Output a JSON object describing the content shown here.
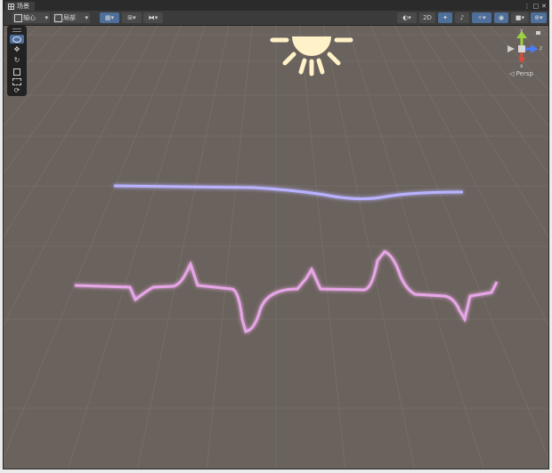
{
  "window": {
    "tab_title": "场景",
    "tab_icon": "grid-icon",
    "controls": [
      "⋮",
      "□",
      "✕"
    ]
  },
  "toolbar": {
    "pivot_label": "轴心",
    "space_label": "局部",
    "mode_2d_label": "2D"
  },
  "gizmo": {
    "axis_y": "y",
    "axis_z": "z",
    "axis_x": "x",
    "persp_label": "◁ Persp"
  },
  "colors": {
    "scene_background": "#6a625c",
    "grid_line": "#77706a",
    "line_upper": "#b8b2ff",
    "line_lower": "#e7a6e6",
    "sun": "#fff2c8",
    "axis_y": "#9cd13f",
    "axis_z": "#4a7bff",
    "axis_x": "#e04a3b"
  },
  "tool_panel": {
    "tools": [
      "view-tool-icon",
      "move-tool-icon",
      "rotate-tool-icon",
      "scale-tool-icon",
      "rect-tool-icon",
      "transform-tool-icon"
    ]
  }
}
